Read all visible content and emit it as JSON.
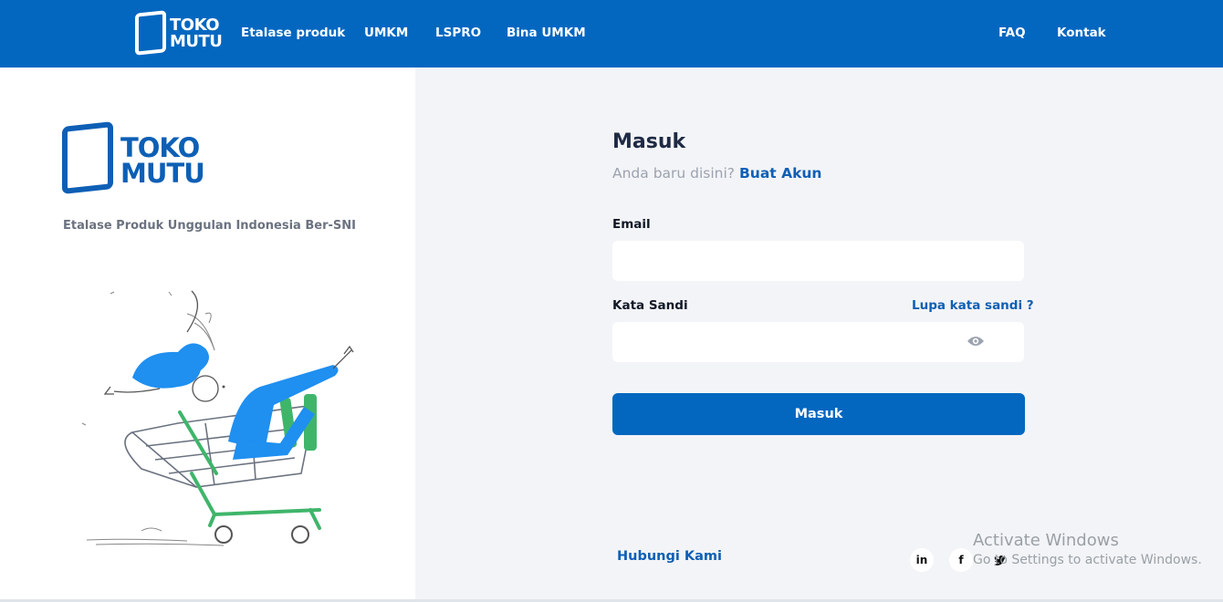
{
  "nav": {
    "logo_line1": "TOKO",
    "logo_line2": "MUTU",
    "links": [
      "Etalase produk",
      "UMKM",
      "LSPRO",
      "Bina UMKM"
    ],
    "right_links": [
      "FAQ",
      "Kontak"
    ]
  },
  "left": {
    "logo_line1": "TOKO",
    "logo_line2": "MUTU",
    "tagline": "Etalase Produk Unggulan Indonesia Ber-SNI",
    "illustration_icon": "shopping-cart-person-illustration"
  },
  "form": {
    "title": "Masuk",
    "subtitle_prefix": "Anda baru disini?",
    "create_account_link": "Buat Akun",
    "email_label": "Email",
    "email_value": "",
    "password_label": "Kata Sandi",
    "forgot_link": "Lupa kata sandi ?",
    "password_value": "",
    "submit_label": "Masuk"
  },
  "footer": {
    "contact_link": "Hubungi Kami",
    "social": [
      "in",
      "f"
    ]
  },
  "watermark": {
    "title": "Activate Windows",
    "subtitle": "Go to Settings to activate Windows."
  },
  "colors": {
    "brand": "#0367c0",
    "link": "#0d5fb5",
    "background": "#f3f4f7"
  }
}
